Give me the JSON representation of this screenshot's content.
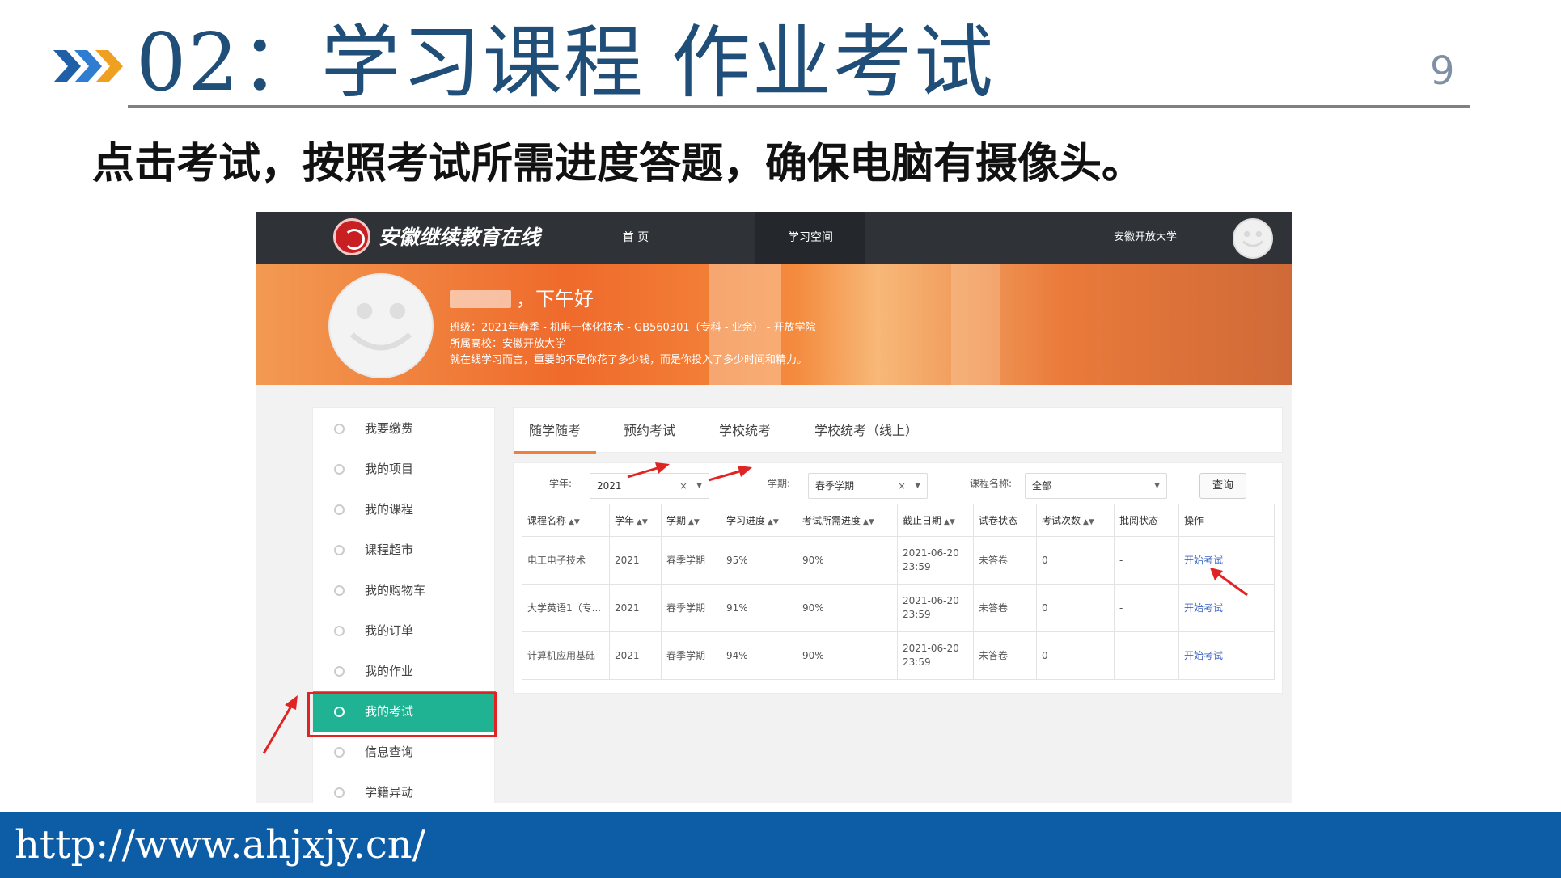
{
  "slide": {
    "title": "02：学习课程 作业考试",
    "page_number": "9",
    "subtitle": "点击考试，按照考试所需进度答题，确保电脑有摄像头。",
    "footer_url": "http://www.ahjxjy.cn/",
    "accent_color": "#1f4e79",
    "footer_color": "#0d5da6"
  },
  "header": {
    "logo_text": "安徽继续教育在线",
    "nav_items": [
      "首 页",
      "学习空间"
    ],
    "active_nav": "学习空间",
    "university": "安徽开放大学"
  },
  "profile": {
    "greeting": "，下午好",
    "class_line": "班级：2021年春季 - 机电一体化技术 - GB560301（专科 - 业余） - 开放学院",
    "school_line": "所属高校：安徽开放大学",
    "motto": "就在线学习而言，重要的不是你花了多少钱，而是你投入了多少时间和精力。"
  },
  "sidebar": {
    "items": [
      "我要缴费",
      "我的项目",
      "我的课程",
      "课程超市",
      "我的购物车",
      "我的订单",
      "我的作业",
      "我的考试",
      "信息查询",
      "学籍异动"
    ],
    "active_item": "我的考试",
    "active_color": "#1fb394"
  },
  "tabs": [
    "随学随考",
    "预约考试",
    "学校统考",
    "学校统考（线上）"
  ],
  "active_tab": "随学随考",
  "filters": {
    "year_label": "学年:",
    "year_value": "2021",
    "term_label": "学期:",
    "term_value": "春季学期",
    "course_label": "课程名称:",
    "course_value": "全部",
    "query_button": "查询",
    "clear_icon": "×"
  },
  "table": {
    "headers": [
      "课程名称",
      "学年",
      "学期",
      "学习进度",
      "考试所需进度",
      "截止日期",
      "试卷状态",
      "考试次数",
      "批阅状态",
      "操作"
    ],
    "rows": [
      [
        "电工电子技术",
        "2021",
        "春季学期",
        "95%",
        "90%",
        "2021-06-20 23:59",
        "未答卷",
        "0",
        "-",
        "开始考试"
      ],
      [
        "大学英语1（专...",
        "2021",
        "春季学期",
        "91%",
        "90%",
        "2021-06-20 23:59",
        "未答卷",
        "0",
        "-",
        "开始考试"
      ],
      [
        "计算机应用基础",
        "2021",
        "春季学期",
        "94%",
        "90%",
        "2021-06-20 23:59",
        "未答卷",
        "0",
        "-",
        "开始考试"
      ]
    ]
  },
  "annotation_color": "#e02424"
}
